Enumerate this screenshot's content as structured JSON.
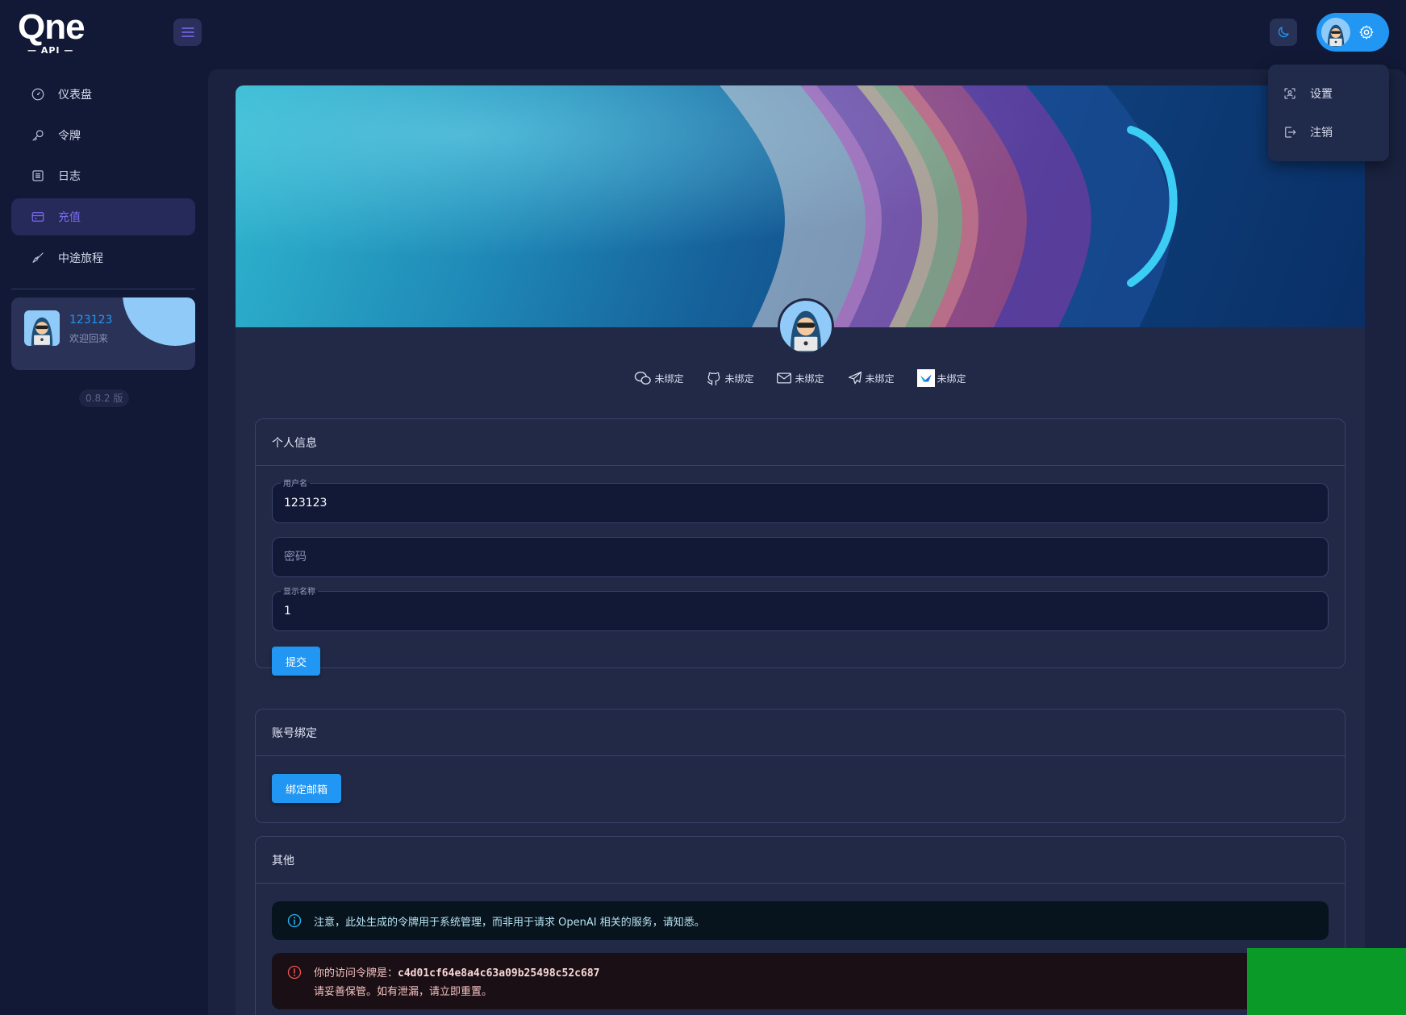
{
  "logo": {
    "wordmark": "Qne",
    "sub": "— API —"
  },
  "header": {
    "menu_icon": "hamburger-icon",
    "theme_icon": "moon-icon",
    "settings_icon": "gear-icon"
  },
  "dropdown": {
    "items": [
      {
        "label": "设置",
        "icon": "settings-scan-icon"
      },
      {
        "label": "注销",
        "icon": "logout-icon"
      }
    ]
  },
  "sidebar": {
    "items": [
      {
        "label": "仪表盘",
        "icon": "dashboard-icon",
        "active": false
      },
      {
        "label": "令牌",
        "icon": "key-icon",
        "active": false
      },
      {
        "label": "日志",
        "icon": "log-icon",
        "active": false
      },
      {
        "label": "充值",
        "icon": "credit-card-icon",
        "active": true
      },
      {
        "label": "中途旅程",
        "icon": "brush-icon",
        "active": false
      }
    ],
    "user": {
      "name": "123123",
      "welcome": "欢迎回来"
    },
    "version": "0.8.2 版"
  },
  "bindings": [
    {
      "label": "未绑定",
      "icon": "wechat-icon"
    },
    {
      "label": "未绑定",
      "icon": "github-icon"
    },
    {
      "label": "未绑定",
      "icon": "email-icon"
    },
    {
      "label": "未绑定",
      "icon": "telegram-icon"
    },
    {
      "label": "未绑定",
      "icon": "lark-icon"
    }
  ],
  "personal": {
    "title": "个人信息",
    "username_label": "用户名",
    "username_value": "123123",
    "password_placeholder": "密码",
    "display_label": "显示名称",
    "display_value": "1",
    "submit": "提交"
  },
  "account_binding": {
    "title": "账号绑定",
    "bind_email": "绑定邮箱"
  },
  "other": {
    "title": "其他",
    "info": "注意，此处生成的令牌用于系统管理，而非用于请求 OpenAI 相关的服务，请知悉。",
    "token_prefix": "你的访问令牌是：",
    "token": "c4d01cf64e8a4c63a09b25498c52c687",
    "token_warning": "请妥善保管。如有泄漏，请立即重置。"
  },
  "colors": {
    "accent": "#2196f3",
    "active_nav": "#7c6cf0",
    "background": "#111936",
    "panel": "#212946",
    "overlay_green": "#0a9a28"
  }
}
